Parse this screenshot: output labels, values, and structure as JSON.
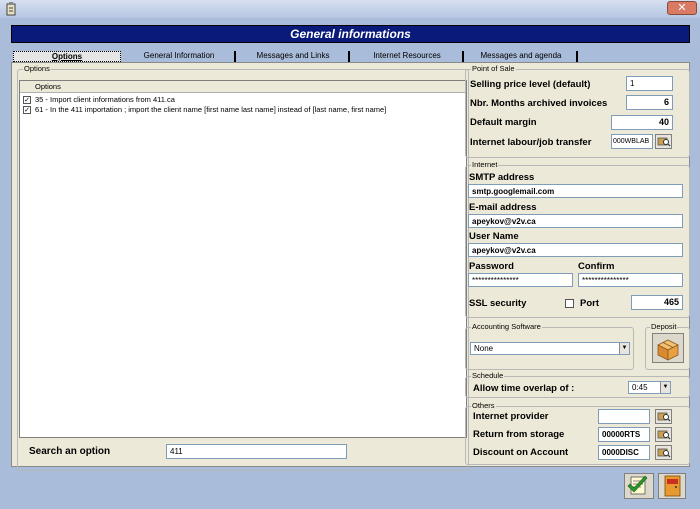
{
  "window": {
    "close_label": "✕"
  },
  "header": {
    "title": "General informations"
  },
  "tabs": [
    {
      "label": "Options",
      "active": true
    },
    {
      "label": "General Information",
      "active": false
    },
    {
      "label": "Messages and Links",
      "active": false
    },
    {
      "label": "Internet Resources",
      "active": false
    },
    {
      "label": "Messages and agenda",
      "active": false
    }
  ],
  "options": {
    "group_title": "Options",
    "column_header": "Options",
    "rows": [
      {
        "checked": true,
        "text": "35 - Import client informations from 411.ca"
      },
      {
        "checked": true,
        "text": "61 - In the 411 importation ; import the client name [first name last name] instead of [last name, first name]"
      }
    ],
    "search_label": "Search an option",
    "search_value": "411"
  },
  "pos": {
    "group_title": "Point of Sale",
    "price_level_label": "Selling price level (default)",
    "price_level_value": "1",
    "months_label": "Nbr. Months archived invoices",
    "months_value": "6",
    "margin_label": "Default margin",
    "margin_value": "40",
    "labour_label": "Internet labour/job transfer",
    "labour_value": "000WBLAB"
  },
  "internet": {
    "group_title": "Internet",
    "smtp_label": "SMTP address",
    "smtp_value": "smtp.googlemail.com",
    "email_label": "E-mail address",
    "email_value": "apeykov@v2v.ca",
    "user_label": "User Name",
    "user_value": "apeykov@v2v.ca",
    "password_label": "Password",
    "password_value": "***************",
    "confirm_label": "Confirm",
    "confirm_value": "***************",
    "ssl_label": "SSL security",
    "port_label": "Port",
    "port_value": "465"
  },
  "accounting": {
    "group_title": "Accounting Software",
    "selected": "None"
  },
  "deposit": {
    "group_title": "Deposit"
  },
  "schedule": {
    "group_title": "Schedule",
    "overlap_label": "Allow time overlap of :",
    "overlap_value": "0:45"
  },
  "others": {
    "group_title": "Others",
    "provider_label": "Internet provider",
    "provider_value": "",
    "storage_label": "Return from storage",
    "storage_value": "00000RTS",
    "discount_label": "Discount on Account",
    "discount_value": "0000DISC"
  },
  "colors": {
    "header_bg": "#0a1a7a",
    "window_bg": "#a9bcd9",
    "panel_bg": "#ece9d8"
  },
  "icons": [
    "app-icon",
    "close-icon",
    "lookup-icon",
    "deposit-box-icon",
    "save-icon",
    "exit-icon"
  ]
}
